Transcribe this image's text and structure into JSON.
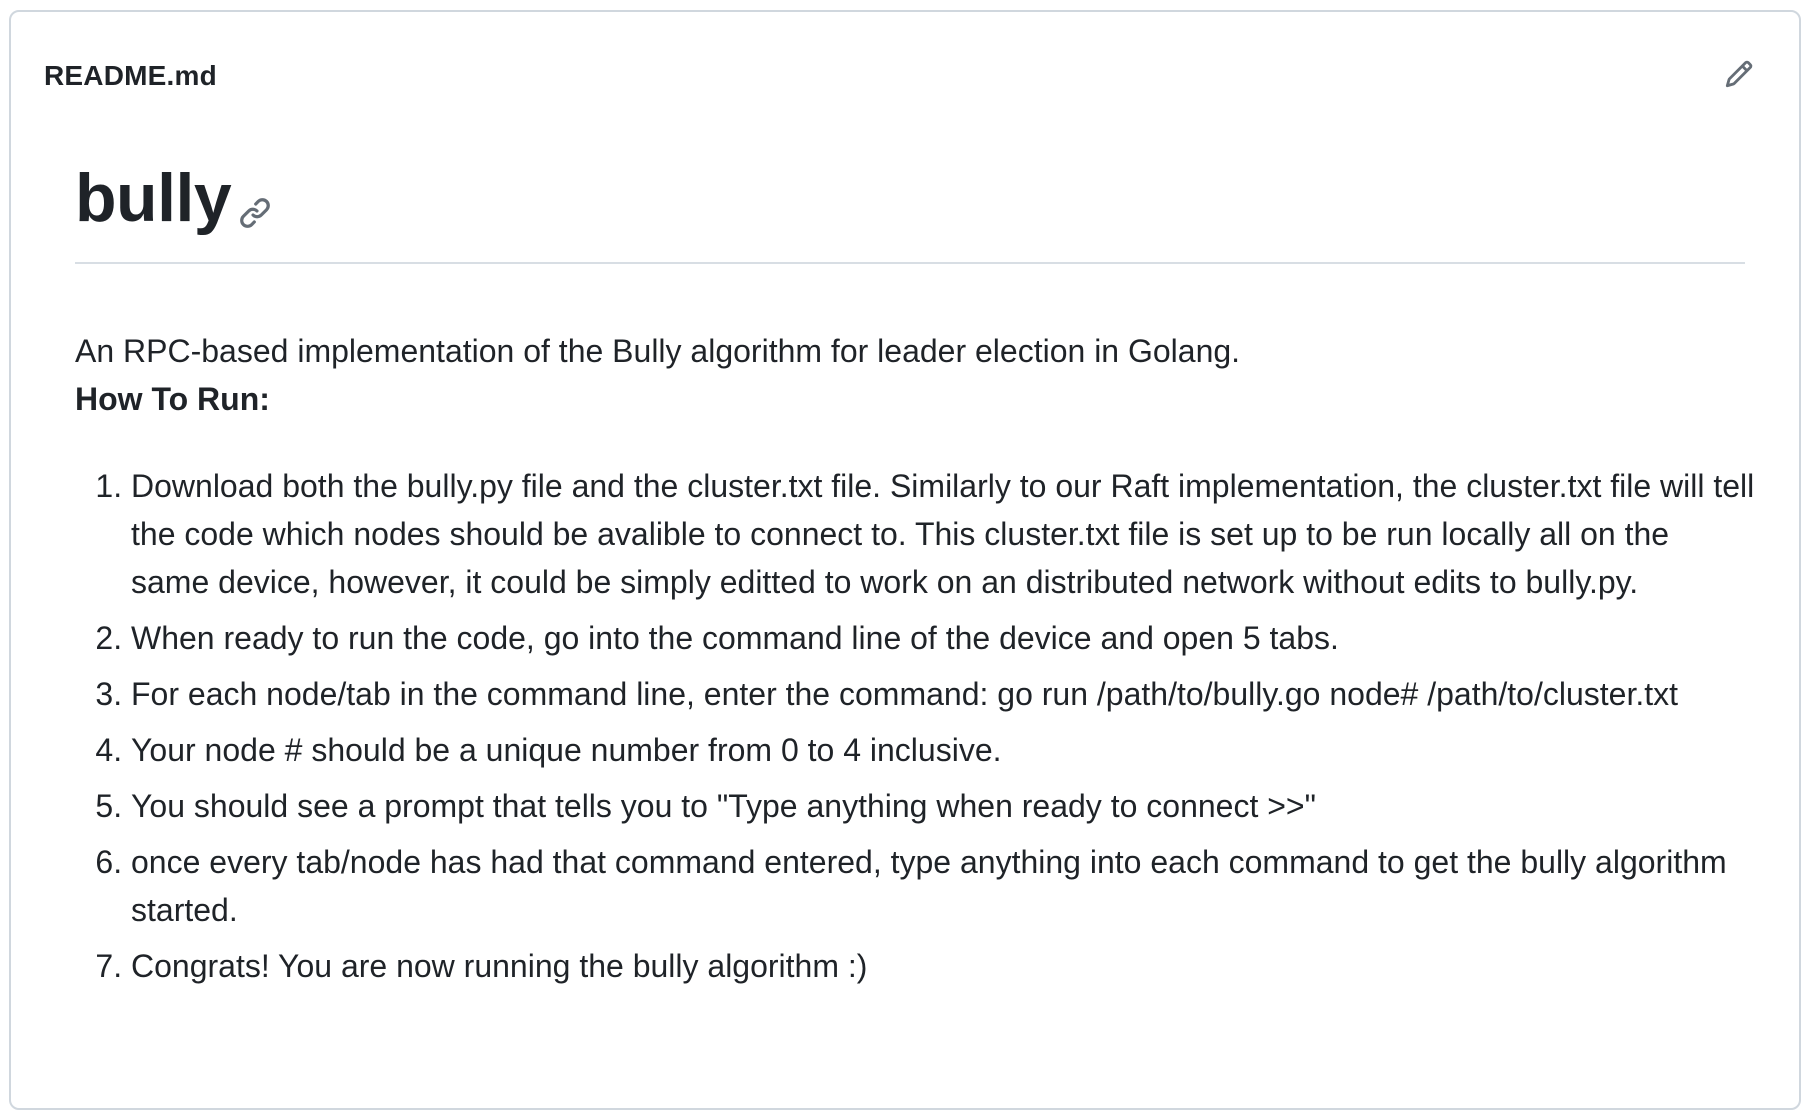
{
  "readme": {
    "file_name": "README.md",
    "edit_icon": "pencil-icon",
    "anchor_icon": "link-icon",
    "title": "bully",
    "intro": "An RPC-based implementation of the Bully algorithm for leader election in Golang.",
    "how_to_heading": "How To Run:",
    "steps": [
      "Download both the bully.py file and the cluster.txt file. Similarly to our Raft implementation, the cluster.txt file will tell the code which nodes should be avalible to connect to. This cluster.txt file is set up to be run locally all on the same device, however, it could be simply editted to work on an distributed network without edits to bully.py.",
      "When ready to run the code, go into the command line of the device and open 5 tabs.",
      "For each node/tab in the command line, enter the command: go run /path/to/bully.go node# /path/to/cluster.txt",
      "Your node # should be a unique number from 0 to 4 inclusive.",
      "You should see a prompt that tells you to \"Type anything when ready to connect >>\"",
      "once every tab/node has had that command entered, type anything into each command to get the bully algorithm started.",
      "Congrats! You are now running the bully algorithm :)"
    ]
  },
  "colors": {
    "text": "#1f2328",
    "border": "#d0d7de",
    "icon": "#656d76"
  }
}
